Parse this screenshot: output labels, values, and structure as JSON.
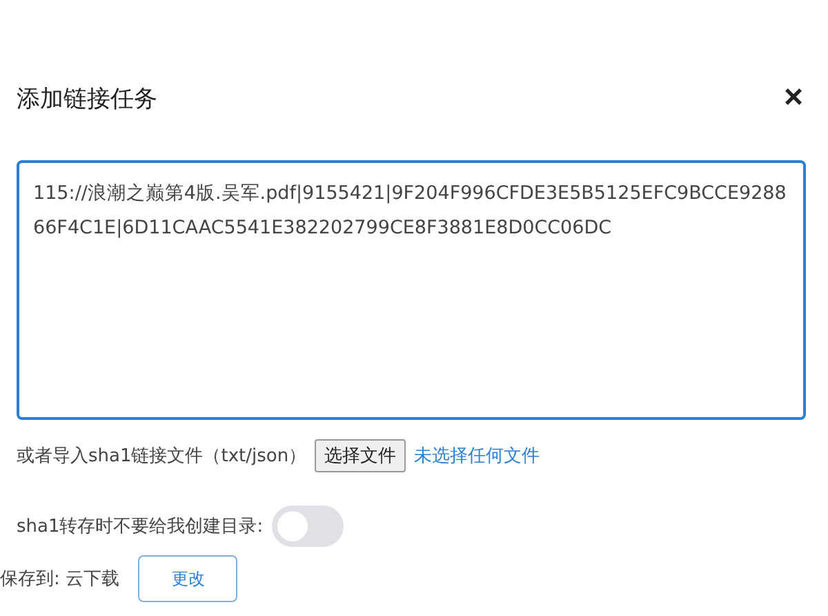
{
  "dialog": {
    "title": "添加链接任务",
    "close": "×"
  },
  "link_field": {
    "value": "115://浪潮之巅第4版.吴军.pdf|9155421|9F204F996CFDE3E5B5125EFC9BCCE928866F4C1E|6D11CAAC5541E382202799CE8F3881E8D0CC06DC"
  },
  "import": {
    "label": "或者导入sha1链接文件（txt/json）",
    "button": "选择文件",
    "status": "未选择任何文件"
  },
  "no_directory": {
    "label": "sha1转存时不要给我创建目录:",
    "on": false
  },
  "save": {
    "label": "保存到:",
    "location": "云下载",
    "button": "更改"
  }
}
